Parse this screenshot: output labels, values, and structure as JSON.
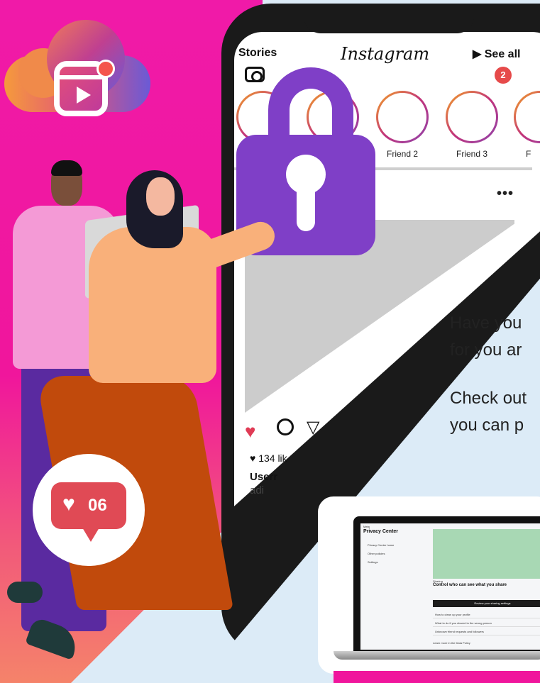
{
  "phone": {
    "stories_label": "Stories",
    "app_name": "Instagram",
    "see_all_label": "▶ See all",
    "notification_count": "2",
    "friends": [
      "Friend 2",
      "Friend 3",
      "F"
    ],
    "more_label": "•••",
    "likes_text": "♥ 134 lik",
    "username_text": "Userr",
    "caption_text": "adi"
  },
  "like_bubble": {
    "heart": "♥",
    "count": "06"
  },
  "text_panel": {
    "line1": "Have you",
    "line2": "for you ar",
    "line3": "Check out",
    "line4": "you can p"
  },
  "laptop_screen": {
    "brand": "Meta",
    "title": "Privacy Center",
    "nav": [
      "Privacy Center home",
      "Other policies",
      "Settings"
    ],
    "category": "Sharing",
    "heading": "Control who can see what you share",
    "button": "Review your sharing settings",
    "rows": [
      "How to clean up your profile",
      "What to do if you shared to the wrong person",
      "Unknown friend requests and followers"
    ],
    "footer": "Learn more in the Data Policy"
  },
  "colors": {
    "magenta": "#f01aa8",
    "lock": "#7f3fc7",
    "light_bg": "#dcebf7",
    "like_red": "#e04a55"
  }
}
